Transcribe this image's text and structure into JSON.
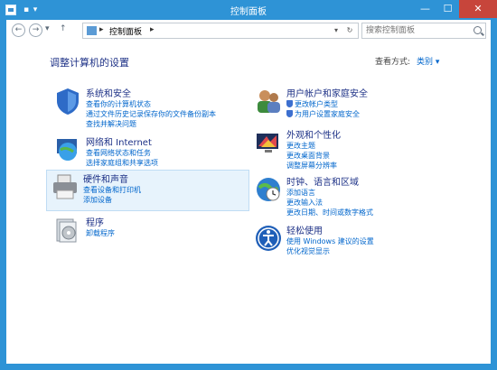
{
  "window": {
    "title": "控制面板"
  },
  "titlebar": {
    "min": "—",
    "max": "☐",
    "close": "✕"
  },
  "nav": {
    "back": "←",
    "forward": "→",
    "up": "↑",
    "dropdown": "▾"
  },
  "address": {
    "path_root": "▸",
    "path": "控制面板",
    "path_arrow": "▸",
    "dropdown": "▾",
    "refresh": "↻"
  },
  "search": {
    "placeholder": "搜索控制面板"
  },
  "header": {
    "title": "调整计算机的设置",
    "view_by_label": "查看方式:",
    "view_by_value": "类别 ▾"
  },
  "categories": [
    {
      "title": "系统和安全",
      "links": [
        "查看你的计算机状态",
        "通过文件历史记录保存你的文件备份副本",
        "查找并解决问题"
      ]
    },
    {
      "title": "用户帐户和家庭安全",
      "links": [
        "更改帐户类型",
        "为用户设置家庭安全"
      ]
    },
    {
      "title": "网络和 Internet",
      "links": [
        "查看网络状态和任务",
        "选择家庭组和共享选项"
      ]
    },
    {
      "title": "外观和个性化",
      "links": [
        "更改主题",
        "更改桌面背景",
        "调整屏幕分辨率"
      ]
    },
    {
      "title": "硬件和声音",
      "links": [
        "查看设备和打印机",
        "添加设备"
      ]
    },
    {
      "title": "时钟、语言和区域",
      "links": [
        "添加语言",
        "更改输入法",
        "更改日期、时间或数字格式"
      ]
    },
    {
      "title": "程序",
      "links": [
        "卸载程序"
      ]
    },
    {
      "title": "轻松使用",
      "links": [
        "使用 Windows 建议的设置",
        "优化视觉显示"
      ]
    }
  ],
  "colors": {
    "titlebar": "#2e93d6",
    "heading": "#1e3287",
    "link": "#0066cc",
    "close": "#c7453b"
  }
}
